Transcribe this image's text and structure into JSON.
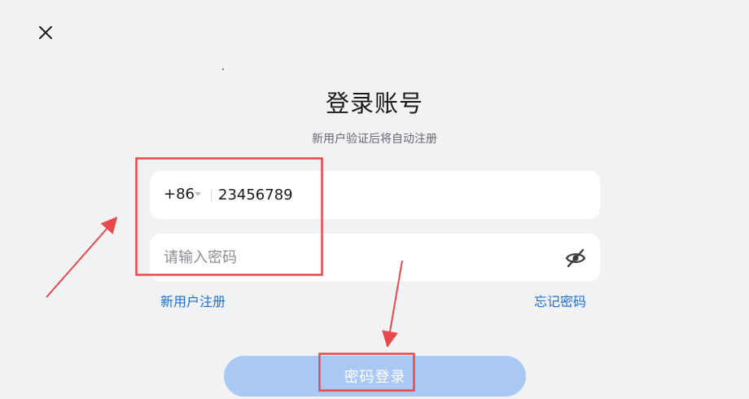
{
  "header": {
    "close_icon": "close-icon"
  },
  "login": {
    "title": "登录账号",
    "subtitle": "新用户验证后将自动注册",
    "phone": {
      "country_code": "+86",
      "value": "23456789"
    },
    "password": {
      "placeholder": "请输入密码",
      "visibility_icon": "eye-off-icon"
    },
    "register_label": "新用户注册",
    "forgot_label": "忘记密码",
    "submit_label": "密码登录"
  },
  "colors": {
    "background": "#f1f2f4",
    "link": "#1d6fd8",
    "button_disabled": "#a9c8f4",
    "annotation": "#e8484a"
  }
}
